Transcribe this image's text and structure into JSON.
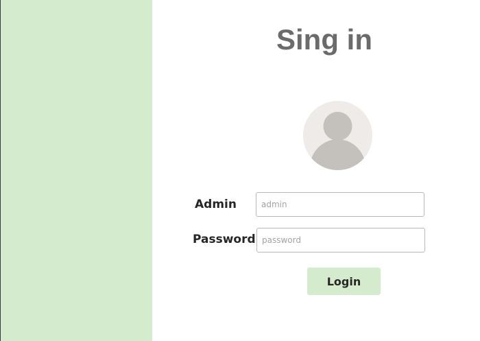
{
  "header": {
    "title": "Sing in"
  },
  "avatar": {
    "icon": "user-silhouette-icon"
  },
  "form": {
    "admin_label": "Admin",
    "admin_placeholder": "admin",
    "admin_value": "",
    "password_label": "Password",
    "password_placeholder": "password",
    "password_value": "",
    "login_label": "Login"
  },
  "colors": {
    "sidebar": "#d4ebcd",
    "title": "#6b6b6b",
    "button": "#d4ebcd",
    "avatar_bg": "#eeebe8",
    "avatar_figure": "#c4c0bb"
  }
}
